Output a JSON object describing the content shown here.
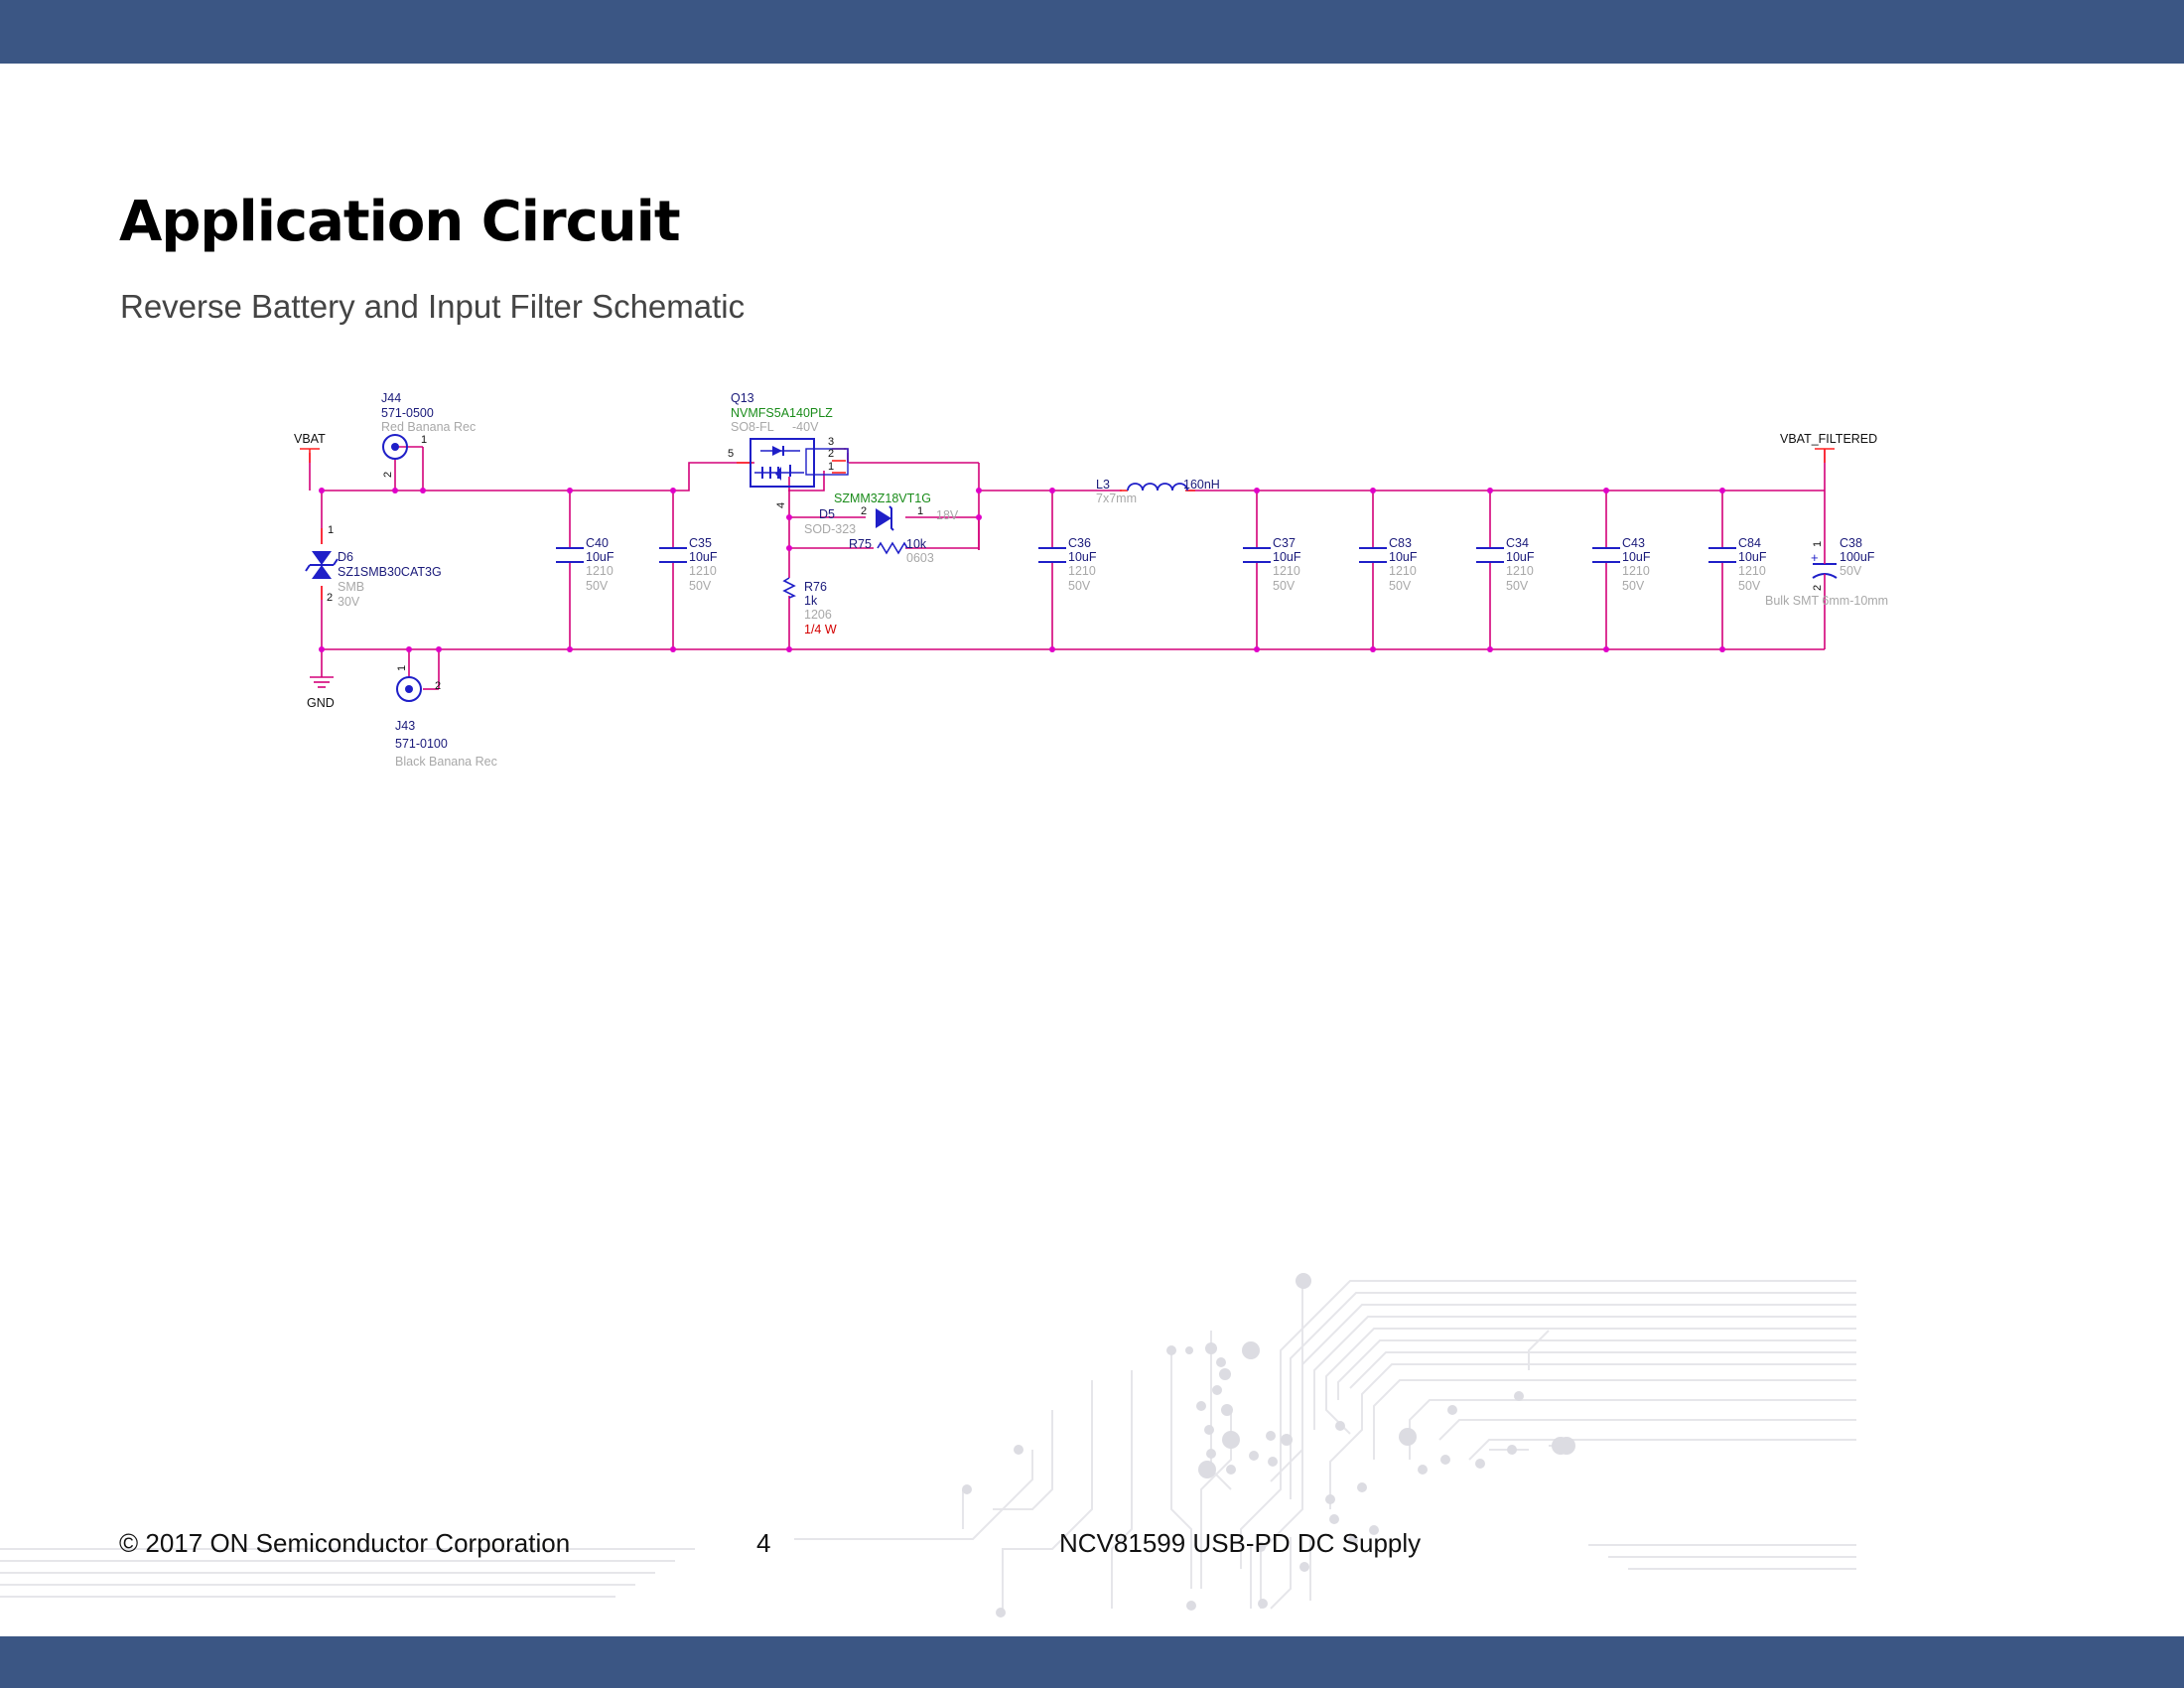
{
  "title": "Application Circuit",
  "subtitle": "Reverse Battery and Input Filter Schematic",
  "footer": {
    "copyright": "© 2017 ON Semiconductor Corporation",
    "page_number": "4",
    "product": "NCV81599 USB-PD DC Supply"
  },
  "colors": {
    "header_bar": "#3b5684",
    "wire": "#d4007a",
    "wire_end": "#ff2020",
    "component": "#1f1fc8",
    "ref_text": "#1a1a7a",
    "part_green": "#1a8c1a",
    "muted_text": "#a8a8a8",
    "power_text": "#d40000"
  },
  "schematic": {
    "nets": {
      "vbat": "VBAT",
      "vbat_filtered": "VBAT_FILTERED",
      "gnd": "GND"
    },
    "j44": {
      "ref": "J44",
      "value": "571-0500",
      "desc": "Red Banana Rec",
      "pin1": "1",
      "pin2": "2"
    },
    "j43": {
      "ref": "J43",
      "value": "571-0100",
      "desc": "Black Banana Rec",
      "pin1": "1",
      "pin2": "2"
    },
    "d6": {
      "ref": "D6",
      "part": "SZ1SMB30CAT3G",
      "package": "SMB",
      "rating": "30V",
      "pin1": "1",
      "pin2": "2"
    },
    "q13": {
      "ref": "Q13",
      "part": "NVMFS5A140PLZ",
      "package": "SO8-FL",
      "rating": "-40V",
      "pin3": "3",
      "pin2": "2",
      "pin1": "1",
      "pin5": "5",
      "pin4": "4"
    },
    "d5": {
      "ref": "D5",
      "part": "SZMM3Z18VT1G",
      "package": "SOD-323",
      "rating": "18V",
      "pin2": "2",
      "pin1": "1"
    },
    "r75": {
      "ref": "R75",
      "value": "10k",
      "package": "0603"
    },
    "r76": {
      "ref": "R76",
      "value": "1k",
      "package": "1206",
      "power": "1/4 W"
    },
    "l3": {
      "ref": "L3",
      "value": "160nH",
      "size": "7x7mm"
    },
    "capacitors": [
      {
        "ref": "C40",
        "value": "10uF",
        "package": "1210",
        "voltage": "50V"
      },
      {
        "ref": "C35",
        "value": "10uF",
        "package": "1210",
        "voltage": "50V"
      },
      {
        "ref": "C36",
        "value": "10uF",
        "package": "1210",
        "voltage": "50V"
      },
      {
        "ref": "C37",
        "value": "10uF",
        "package": "1210",
        "voltage": "50V"
      },
      {
        "ref": "C83",
        "value": "10uF",
        "package": "1210",
        "voltage": "50V"
      },
      {
        "ref": "C34",
        "value": "10uF",
        "package": "1210",
        "voltage": "50V"
      },
      {
        "ref": "C43",
        "value": "10uF",
        "package": "1210",
        "voltage": "50V"
      },
      {
        "ref": "C84",
        "value": "10uF",
        "package": "1210",
        "voltage": "50V"
      }
    ],
    "c38": {
      "ref": "C38",
      "value": "100uF",
      "voltage": "50V",
      "package": "Bulk SMT 6mm-10mm",
      "pin1": "1",
      "pin2": "2",
      "polarity": "+"
    }
  }
}
